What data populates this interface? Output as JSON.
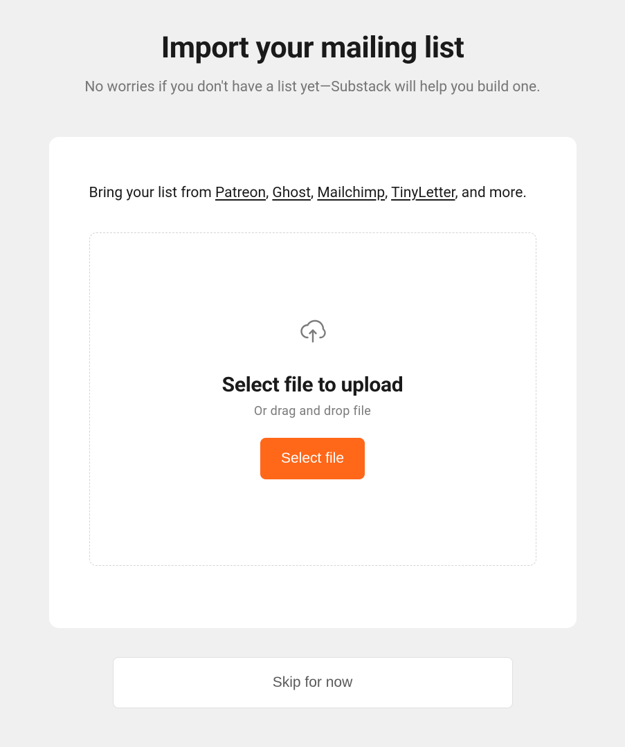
{
  "header": {
    "title": "Import your mailing list",
    "subtitle": "No worries if you don't have a list yet—Substack will help you build one."
  },
  "card": {
    "source_prefix": "Bring your list from ",
    "sources": [
      {
        "label": "Patreon"
      },
      {
        "label": "Ghost"
      },
      {
        "label": "Mailchimp"
      },
      {
        "label": "TinyLetter"
      }
    ],
    "source_suffix": ", and more.",
    "separator": ", "
  },
  "upload": {
    "title": "Select file to upload",
    "subtitle": "Or drag and drop file",
    "button": "Select file"
  },
  "skip": {
    "label": "Skip for now"
  },
  "colors": {
    "accent": "#ff6719"
  }
}
